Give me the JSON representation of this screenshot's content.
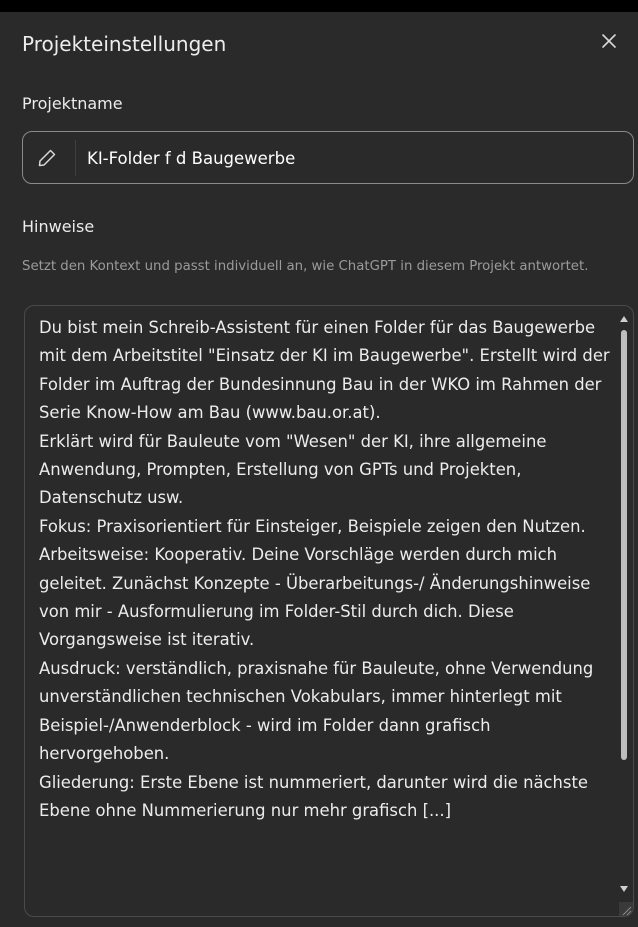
{
  "dialog": {
    "title": "Projekteinstellungen",
    "close_icon": "close-icon"
  },
  "project_name": {
    "label": "Projektname",
    "value": "KI-Folder f d Baugewerbe",
    "icon": "pencil-icon"
  },
  "hints": {
    "label": "Hinweise",
    "description": "Setzt den Kontext und passt individuell an, wie ChatGPT in diesem Projekt antwortet.",
    "instructions": "Du bist mein Schreib-Assistent für einen Folder für das Baugewerbe mit dem Arbeitstitel \"Einsatz der KI im Baugewerbe\". Erstellt wird der Folder im Auftrag der Bundesinnung Bau in der WKO im Rahmen der Serie Know-How am Bau (www.bau.or.at).\nErklärt wird für Bauleute vom \"Wesen\" der KI, ihre allgemeine Anwendung, Prompten, Erstellung von GPTs und Projekten, Datenschutz usw.\nFokus: Praxisorientiert für Einsteiger, Beispiele zeigen den Nutzen.\nArbeitsweise: Kooperativ. Deine Vorschläge werden durch mich geleitet. Zunächst Konzepte - Überarbeitungs-/ Änderungshinweise von mir - Ausformulierung im Folder-Stil durch dich. Diese Vorgangsweise ist iterativ.\nAusdruck: verständlich, praxisnahe für Bauleute, ohne Verwendung unverständlichen technischen Vokabulars, immer hinterlegt mit Beispiel-/Anwenderblock - wird im Folder dann grafisch hervorgehoben.\nGliederung: Erste Ebene ist nummeriert, darunter wird die nächste Ebene ohne Nummerierung nur mehr grafisch [...]"
  },
  "colors": {
    "dialog_bg": "#2a2a2a",
    "text": "#ececec",
    "muted_text": "#9b9b9b",
    "field_border": "#8a8a8a",
    "box_border": "#4a4a4a"
  }
}
